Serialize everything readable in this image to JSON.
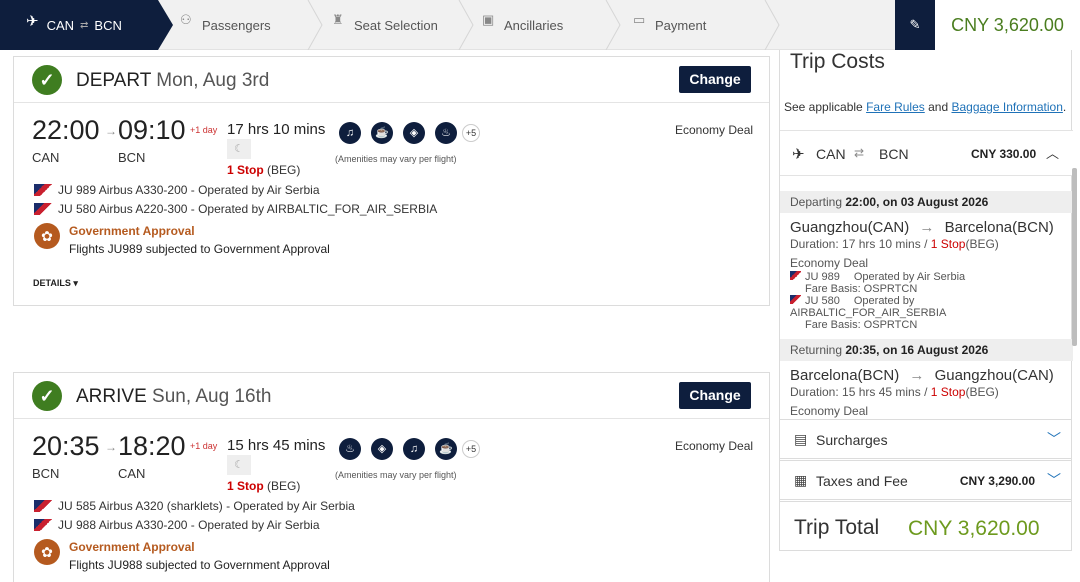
{
  "stepper": {
    "route_from": "CAN",
    "route_to": "BCN",
    "steps": [
      "Passengers",
      "Seat Selection",
      "Ancillaries",
      "Payment"
    ],
    "total": "CNY 3,620.00"
  },
  "depart": {
    "label": "DEPART",
    "date": "Mon, Aug 3rd",
    "change": "Change",
    "dep_time": "22:00",
    "arr_time": "09:10",
    "plus_day": "+1 day",
    "duration": "17 hrs 10 mins",
    "dep_code": "CAN",
    "arr_code": "BCN",
    "stops": "1 Stop",
    "stop_via": "(BEG)",
    "amenities_more": "+5",
    "amenities_note": "(Amenities may vary per flight)",
    "fare": "Economy Deal",
    "flights": [
      "JU 989  Airbus A330-200  -  Operated by Air Serbia",
      "JU 580  Airbus A220-300  -  Operated by AIRBALTIC_FOR_AIR_SERBIA"
    ],
    "gov_title": "Government Approval",
    "gov_sub": "Flights JU989 subjected to Government Approval",
    "details": "DETAILS ▾"
  },
  "arrive": {
    "label": "ARRIVE",
    "date": "Sun, Aug 16th",
    "change": "Change",
    "dep_time": "20:35",
    "arr_time": "18:20",
    "plus_day": "+1 day",
    "duration": "15 hrs 45 mins",
    "dep_code": "BCN",
    "arr_code": "CAN",
    "stops": "1 Stop",
    "stop_via": "(BEG)",
    "amenities_more": "+5",
    "amenities_note": "(Amenities may vary per flight)",
    "fare": "Economy Deal",
    "flights": [
      "JU 585  Airbus A320 (sharklets)  -  Operated by Air Serbia",
      "JU 988  Airbus A330-200  -  Operated by Air Serbia"
    ],
    "gov_title": "Government Approval",
    "gov_sub": "Flights JU988 subjected to Government Approval"
  },
  "trip_costs": {
    "title": "Trip Costs",
    "see_text": "See applicable",
    "fare_rules": "Fare Rules",
    "and": "and",
    "baggage": "Baggage Information",
    "route_from": "CAN",
    "route_to": "BCN",
    "route_amount": "CNY 330.00",
    "departing_label": "Departing",
    "departing_value": "22:00, on 03 August 2026",
    "out_from": "Guangzhou(CAN)",
    "out_to": "Barcelona(BCN)",
    "out_duration": "Duration: 17 hrs 10 mins /",
    "out_stop": "1 Stop",
    "out_via": "(BEG)",
    "out_fare": "Economy Deal",
    "out_fl1": "JU 989",
    "out_fl1_op": "Operated by Air Serbia",
    "out_fl1_basis": "Fare Basis: OSPRTCN",
    "out_fl2": "JU 580",
    "out_fl2_op": "Operated by",
    "out_fl2_op2": "AIRBALTIC_FOR_AIR_SERBIA",
    "out_fl2_basis": "Fare Basis: OSPRTCN",
    "returning_label": "Returning",
    "returning_value": "20:35, on 16 August 2026",
    "ret_from": "Barcelona(BCN)",
    "ret_to": "Guangzhou(CAN)",
    "ret_duration": "Duration: 15 hrs 45 mins /",
    "ret_stop": "1 Stop",
    "ret_via": "(BEG)",
    "ret_fare": "Economy Deal",
    "surcharges": "Surcharges",
    "taxes": "Taxes and Fee",
    "taxes_amount": "CNY 3,290.00",
    "total_label": "Trip Total",
    "total_value": "CNY 3,620.00"
  }
}
